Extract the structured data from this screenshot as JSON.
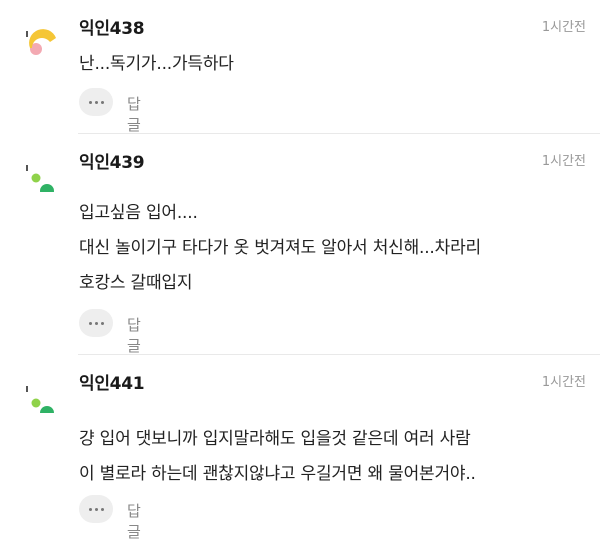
{
  "comments": [
    {
      "avatar": "avatar-yellow-pink",
      "author": "익인438",
      "time": "1시간전",
      "lines": [
        "난...독기가...가득하다"
      ],
      "reply_label": "답글",
      "more_icon": "more-dots-icon"
    },
    {
      "avatar": "avatar-green-dots",
      "author": "익인439",
      "time": "1시간전",
      "lines": [
        "입고싶음 입어....",
        "대신 놀이기구 타다가 옷 벗겨져도 알아서 처신해...차라리",
        "호캉스 갈때입지"
      ],
      "reply_label": "답글",
      "more_icon": "more-dots-icon"
    },
    {
      "avatar": "avatar-green-dots",
      "author": "익인441",
      "time": "1시간전",
      "lines": [
        "걍 입어 댓보니까 입지말라해도 입을것 같은데 여러 사람",
        "이 별로라 하는데 괜찮지않냐고 우길거면 왜 물어본거야.."
      ],
      "reply_label": "답글",
      "more_icon": "more-dots-icon"
    }
  ],
  "colors": {
    "avatar_yellow": "#f5c636",
    "avatar_pink": "#f3a9b2",
    "avatar_green_light": "#8fd24a",
    "avatar_green": "#2fb265",
    "divider": "#e9e9e9",
    "muted_text": "#999999"
  }
}
